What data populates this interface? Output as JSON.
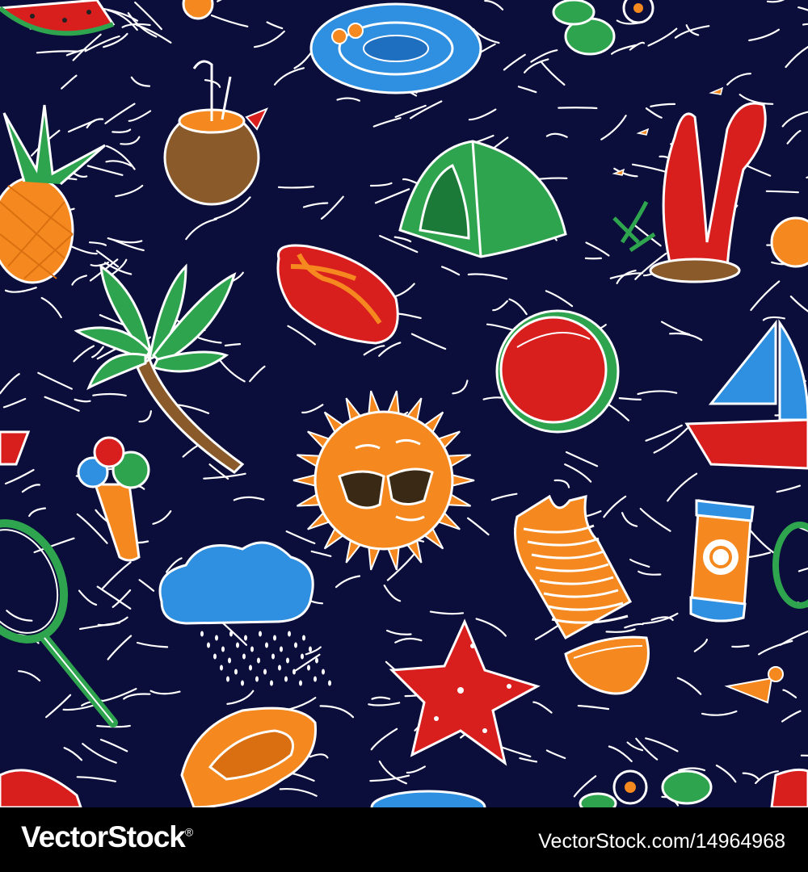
{
  "pattern": {
    "background_color": "#0b0d3a",
    "stroke_color": "#ffffff",
    "palette": {
      "red": "#d91e1e",
      "orange": "#f5891f",
      "green": "#2ea44f",
      "blue": "#2f8fe0",
      "brown": "#8a5a2b",
      "white": "#ffffff"
    },
    "motifs": [
      "watermelon-slice-icon",
      "coconut-drink-icon",
      "pool-float-icon",
      "flower-leaves-icon",
      "pineapple-icon",
      "tent-icon",
      "coral-reef-icon",
      "flip-flop-icon",
      "palm-tree-icon",
      "beach-ball-icon",
      "sailboat-icon",
      "ice-cream-cone-icon",
      "sun-sunglasses-icon",
      "tennis-racket-icon",
      "rain-cloud-icon",
      "swim-tank-top-icon",
      "swim-briefs-icon",
      "sunscreen-bottle-icon",
      "starfish-icon",
      "shuttlecock-icon",
      "sandal-icon"
    ]
  },
  "footer": {
    "brand": "VectorStock",
    "registered_mark": "®",
    "image_url": "VectorStock.com/14964968"
  }
}
